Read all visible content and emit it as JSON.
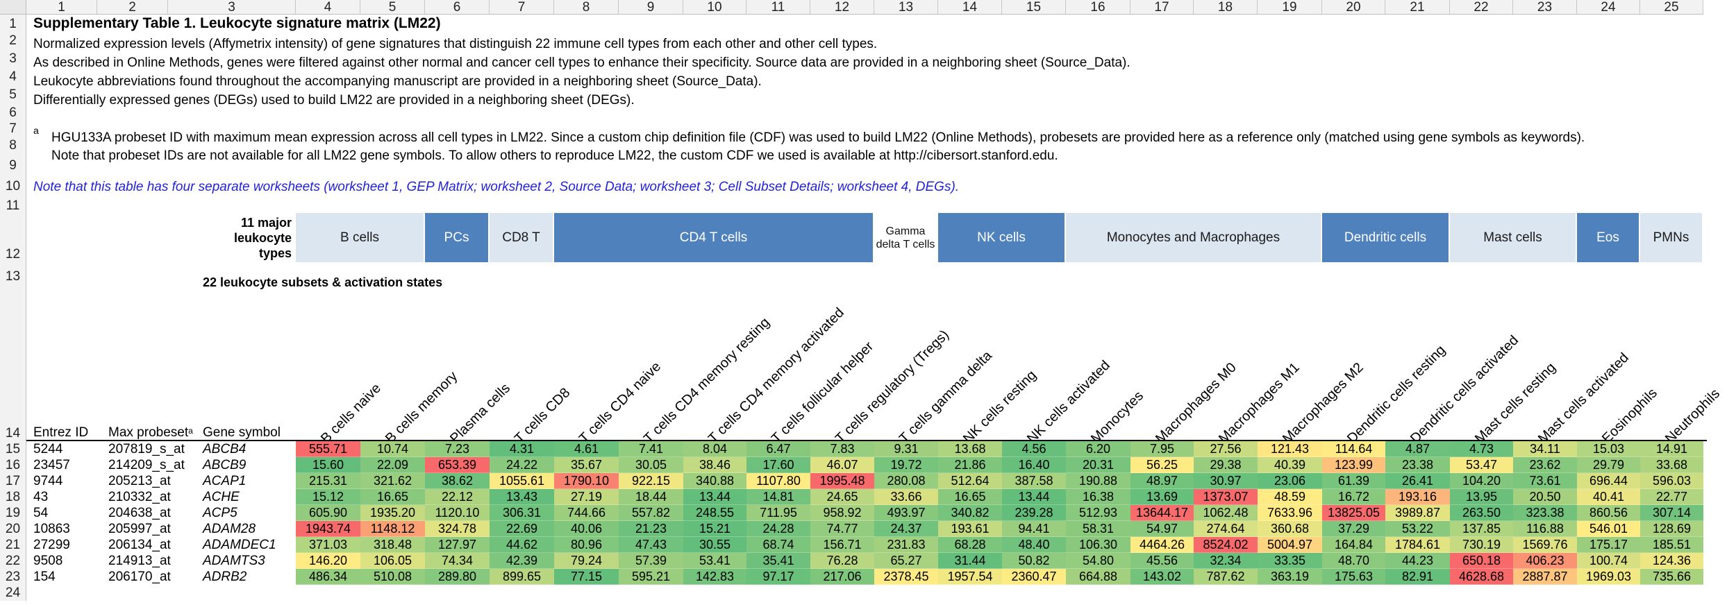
{
  "columns": [
    "1",
    "2",
    "3",
    "4",
    "5",
    "6",
    "7",
    "8",
    "9",
    "10",
    "11",
    "12",
    "13",
    "14",
    "15",
    "16",
    "17",
    "18",
    "19",
    "20",
    "21",
    "22",
    "23",
    "24",
    "25"
  ],
  "row_numbers": [
    "1",
    "2",
    "3",
    "4",
    "5",
    "6",
    "7",
    "8",
    "9",
    "10",
    "11",
    "12",
    "13",
    "14",
    "15",
    "16",
    "17",
    "18",
    "19",
    "20",
    "21",
    "22",
    "23",
    "24"
  ],
  "title": "Supplementary Table 1. Leukocyte signature matrix (LM22)",
  "lines": {
    "r2": "Normalized expression levels (Affymetrix intensity) of gene signatures that distinguish 22 immune cell types from each other and other cell types.",
    "r3": "As described in Online Methods, genes were filtered against other normal and cancer cell types to enhance their specificity. Source data are provided in a neighboring sheet (Source_Data).",
    "r4": "Leukocyte abbreviations found throughout the accompanying manuscript are provided in a neighboring sheet (Source_Data).",
    "r5": "Differentially expressed genes (DEGs) used to build LM22 are provided in a neighboring sheet (DEGs).",
    "r7_marker": "a",
    "r7": "HGU133A probeset ID with maximum mean expression across all cell types in LM22. Since a custom chip definition file (CDF) was used to build LM22 (Online Methods), probesets are provided here as a reference only (matched using gene symbols as keywords).",
    "r8": "Note that probeset IDs are not available for all LM22 gene symbols. To allow others to reproduce LM22, the custom CDF we used is available at http://cibersort.stanford.edu.",
    "r10": "Note that this table has four separate worksheets (worksheet 1, GEP Matrix; worksheet 2, Source Data; worksheet 3; Cell Subset Details; worksheet 4, DEGs).",
    "r13": "22 leukocyte subsets & activation states"
  },
  "major_types_label": "11 major leukocyte types",
  "major_types": [
    {
      "label": "B cells",
      "span": 2,
      "style": "light"
    },
    {
      "label": "PCs",
      "span": 1,
      "style": "dark"
    },
    {
      "label": "CD8 T",
      "span": 1,
      "style": "light"
    },
    {
      "label": "CD4 T cells",
      "span": 5,
      "style": "dark"
    },
    {
      "label": "Gamma delta T cells",
      "span": 1,
      "style": "white"
    },
    {
      "label": "NK cells",
      "span": 2,
      "style": "dark"
    },
    {
      "label": "Monocytes and Macrophages",
      "span": 4,
      "style": "light"
    },
    {
      "label": "Dendritic cells",
      "span": 2,
      "style": "dark"
    },
    {
      "label": "Mast cells",
      "span": 2,
      "style": "light"
    },
    {
      "label": "Eos",
      "span": 1,
      "style": "dark"
    },
    {
      "label": "PMNs",
      "span": 1,
      "style": "light"
    }
  ],
  "header": {
    "entrez": "Entrez ID",
    "probeset": "Max probeset",
    "probeset_marker": "a",
    "gene": "Gene symbol"
  },
  "cell_types": [
    "B cells naive",
    "B cells memory",
    "Plasma cells",
    "T cells CD8",
    "T cells CD4 naive",
    "T cells CD4 memory resting",
    "T cells CD4 memory activated",
    "T cells follicular helper",
    "T cells regulatory (Tregs)",
    "T cells gamma delta",
    "NK cells resting",
    "NK cells activated",
    "Monocytes",
    "Macrophages M0",
    "Macrophages M1",
    "Macrophages M2",
    "Dendritic cells resting",
    "Dendritic cells activated",
    "Mast cells resting",
    "Mast cells activated",
    "Eosinophils",
    "Neutrophils"
  ],
  "heatmap_colors": {
    "low": "#63be7b",
    "mid": "#ffeb84",
    "high": "#f8696b"
  },
  "rows": [
    {
      "entrez": "5244",
      "probeset": "207819_s_at",
      "gene": "ABCB4",
      "values": [
        "555.71",
        "10.74",
        "7.23",
        "4.31",
        "4.61",
        "7.41",
        "8.04",
        "6.47",
        "7.83",
        "9.31",
        "13.68",
        "4.56",
        "6.20",
        "7.95",
        "27.56",
        "121.43",
        "114.64",
        "4.87",
        "4.73",
        "34.11",
        "15.03",
        "14.91"
      ]
    },
    {
      "entrez": "23457",
      "probeset": "214209_s_at",
      "gene": "ABCB9",
      "values": [
        "15.60",
        "22.09",
        "653.39",
        "24.22",
        "35.67",
        "30.05",
        "38.46",
        "17.60",
        "46.07",
        "19.72",
        "21.86",
        "16.40",
        "20.31",
        "56.25",
        "29.38",
        "40.39",
        "123.99",
        "23.38",
        "53.47",
        "23.62",
        "29.79",
        "33.68"
      ]
    },
    {
      "entrez": "9744",
      "probeset": "205213_at",
      "gene": "ACAP1",
      "values": [
        "215.31",
        "321.62",
        "38.62",
        "1055.61",
        "1790.10",
        "922.15",
        "340.88",
        "1107.80",
        "1995.48",
        "280.08",
        "512.64",
        "387.58",
        "190.88",
        "48.97",
        "30.97",
        "23.06",
        "61.39",
        "26.41",
        "104.20",
        "73.61",
        "696.44",
        "596.03"
      ]
    },
    {
      "entrez": "43",
      "probeset": "210332_at",
      "gene": "ACHE",
      "values": [
        "15.12",
        "16.65",
        "22.12",
        "13.43",
        "27.19",
        "18.44",
        "13.44",
        "14.81",
        "24.65",
        "33.66",
        "16.65",
        "13.44",
        "16.38",
        "13.69",
        "1373.07",
        "48.59",
        "16.72",
        "193.16",
        "13.95",
        "20.50",
        "40.41",
        "22.77"
      ]
    },
    {
      "entrez": "54",
      "probeset": "204638_at",
      "gene": "ACP5",
      "values": [
        "605.90",
        "1935.20",
        "1120.10",
        "306.31",
        "744.66",
        "557.82",
        "248.55",
        "711.95",
        "958.92",
        "493.97",
        "340.82",
        "239.28",
        "512.93",
        "13644.17",
        "1062.48",
        "7633.96",
        "13825.05",
        "3989.87",
        "263.50",
        "323.38",
        "860.56",
        "307.14"
      ]
    },
    {
      "entrez": "10863",
      "probeset": "205997_at",
      "gene": "ADAM28",
      "values": [
        "1943.74",
        "1148.12",
        "324.78",
        "22.69",
        "40.06",
        "21.23",
        "15.21",
        "24.28",
        "74.77",
        "24.37",
        "193.61",
        "94.41",
        "58.31",
        "54.97",
        "274.64",
        "360.68",
        "37.29",
        "53.22",
        "137.85",
        "116.88",
        "546.01",
        "128.69"
      ]
    },
    {
      "entrez": "27299",
      "probeset": "206134_at",
      "gene": "ADAMDEC1",
      "values": [
        "371.03",
        "318.48",
        "127.97",
        "44.62",
        "80.96",
        "47.43",
        "30.55",
        "68.74",
        "156.71",
        "231.83",
        "68.28",
        "48.40",
        "106.30",
        "4464.26",
        "8524.02",
        "5004.97",
        "164.84",
        "1784.61",
        "730.19",
        "1569.76",
        "175.17",
        "185.51"
      ]
    },
    {
      "entrez": "9508",
      "probeset": "214913_at",
      "gene": "ADAMTS3",
      "values": [
        "146.20",
        "106.05",
        "74.34",
        "42.39",
        "79.24",
        "57.39",
        "53.41",
        "35.41",
        "76.28",
        "65.27",
        "31.44",
        "50.82",
        "54.80",
        "45.56",
        "32.34",
        "33.35",
        "48.70",
        "44.23",
        "650.18",
        "406.23",
        "100.74",
        "124.36"
      ]
    },
    {
      "entrez": "154",
      "probeset": "206170_at",
      "gene": "ADRB2",
      "values": [
        "486.34",
        "510.08",
        "289.80",
        "899.65",
        "77.15",
        "595.21",
        "142.83",
        "97.17",
        "217.06",
        "2378.45",
        "1957.54",
        "2360.47",
        "664.88",
        "143.02",
        "787.62",
        "363.19",
        "175.63",
        "82.91",
        "4628.68",
        "2887.87",
        "1969.03",
        "735.66"
      ]
    }
  ]
}
